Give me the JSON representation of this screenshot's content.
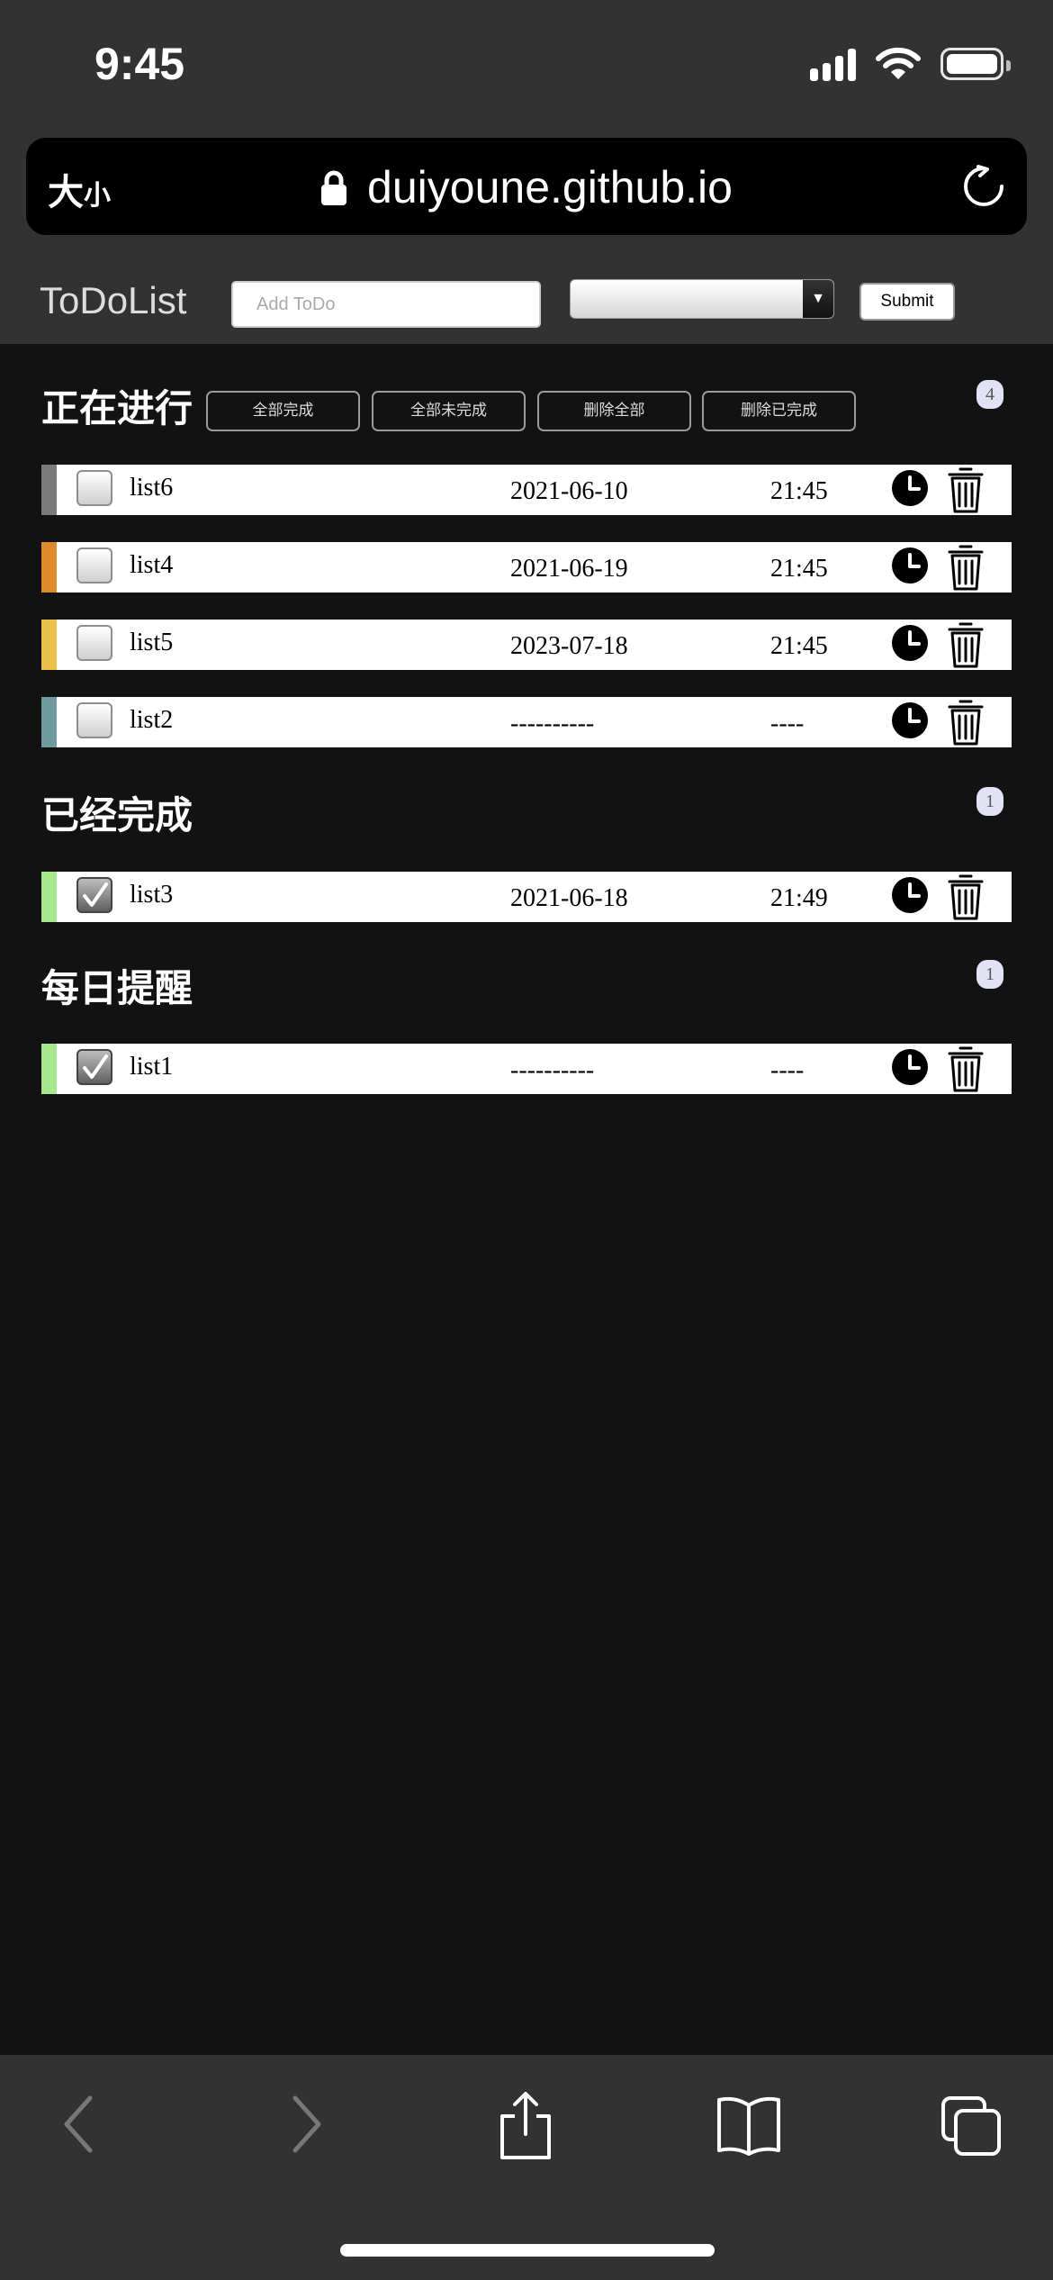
{
  "status_bar": {
    "time": "9:45"
  },
  "address_bar": {
    "text_size_big": "大",
    "text_size_small": "小",
    "url": "duiyoune.github.io"
  },
  "header": {
    "title": "ToDoList",
    "input_placeholder": "Add ToDo",
    "select_value": "",
    "submit_label": "Submit"
  },
  "sections": [
    {
      "title": "正在进行",
      "count": "4"
    },
    {
      "title": "已经完成",
      "count": "1"
    },
    {
      "title": "每日提醒",
      "count": "1"
    }
  ],
  "bulk_actions": [
    "全部完成",
    "全部未完成",
    "删除全部",
    "删除已完成"
  ],
  "todos": [
    {
      "name": "list6",
      "date": "2021-06-10",
      "time": "21:45",
      "checked": false,
      "color": "#7a7a7a"
    },
    {
      "name": "list4",
      "date": "2021-06-19",
      "time": "21:45",
      "checked": false,
      "color": "#e08a2e"
    },
    {
      "name": "list5",
      "date": "2023-07-18",
      "time": "21:45",
      "checked": false,
      "color": "#e8c04a"
    },
    {
      "name": "list2",
      "date": "----------",
      "time": "----",
      "checked": false,
      "color": "#6e9aa0"
    },
    {
      "name": "list3",
      "date": "2021-06-18",
      "time": "21:49",
      "checked": true,
      "color": "#a6e88e"
    },
    {
      "name": "list1",
      "date": "----------",
      "time": "----",
      "checked": true,
      "color": "#a6e88e"
    }
  ],
  "icons": {
    "lock": "lock-icon",
    "reload": "reload-icon",
    "clock": "clock-icon",
    "trash": "trash-icon",
    "back": "back-icon",
    "forward": "forward-icon",
    "share": "share-icon",
    "bookmarks": "bookmarks-icon",
    "tabs": "tabs-icon"
  }
}
